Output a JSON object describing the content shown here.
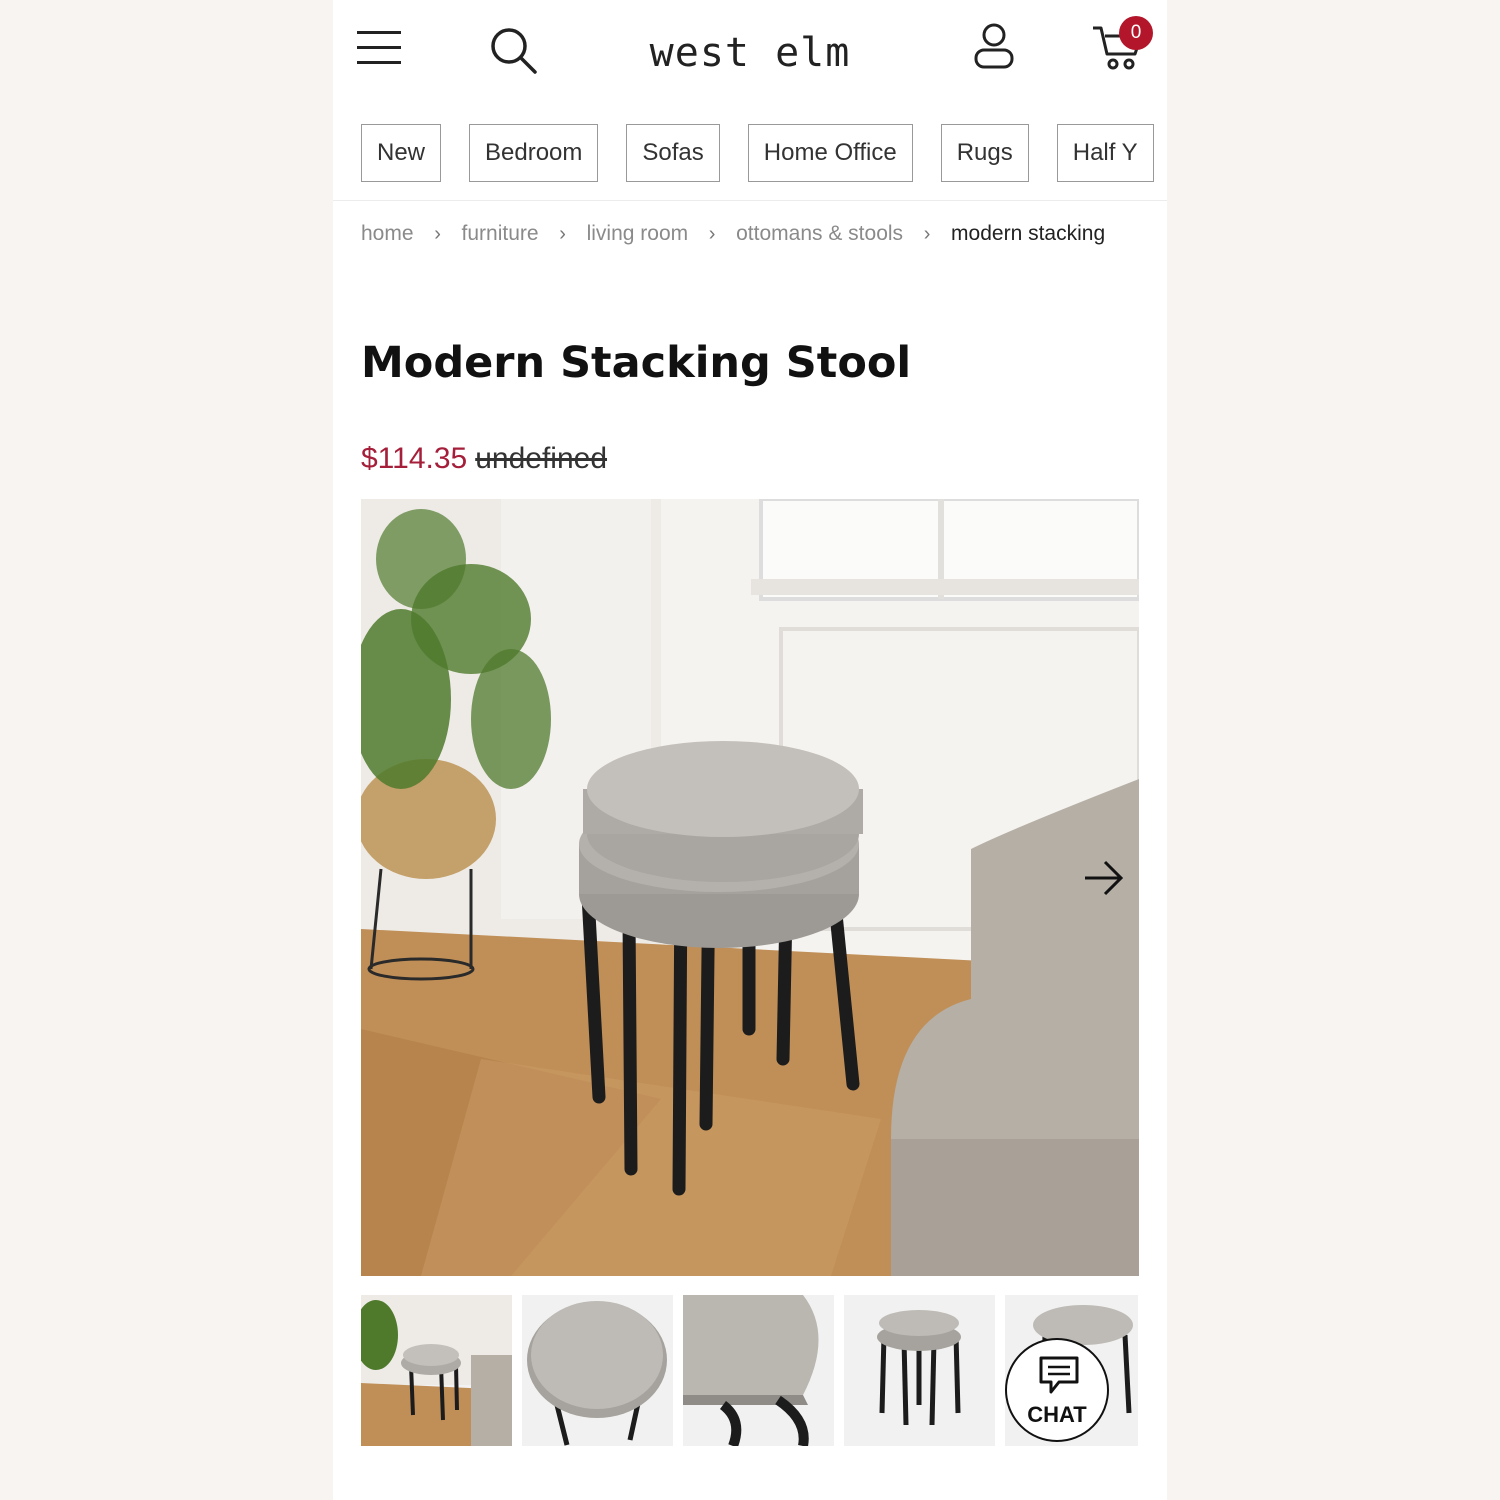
{
  "header": {
    "logo": "west elm",
    "cart_count": "0"
  },
  "nav": {
    "tabs": [
      "New",
      "Bedroom",
      "Sofas",
      "Home Office",
      "Rugs",
      "Half Y"
    ]
  },
  "breadcrumb": [
    "home",
    "furniture",
    "living room",
    "ottomans & stools",
    "modern stacking"
  ],
  "product": {
    "title": "Modern Stacking Stool",
    "price_sale": "$114.35",
    "price_original": "undefined"
  },
  "chat": {
    "label": "CHAT"
  },
  "colors": {
    "accent": "#b3162b",
    "sale_price": "#a51f3a"
  },
  "icons": [
    "menu-icon",
    "search-icon",
    "user-icon",
    "cart-icon",
    "arrow-right-icon",
    "chevron-right-icon",
    "chat-bubble-icon"
  ]
}
